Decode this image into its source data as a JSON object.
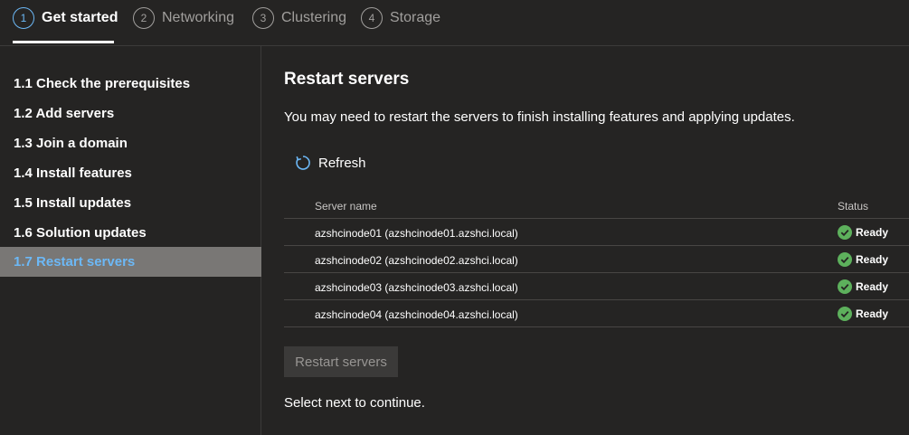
{
  "steps": [
    {
      "num": "1",
      "label": "Get started"
    },
    {
      "num": "2",
      "label": "Networking"
    },
    {
      "num": "3",
      "label": "Clustering"
    },
    {
      "num": "4",
      "label": "Storage"
    }
  ],
  "sidebar": {
    "items": [
      {
        "label": "1.1  Check the prerequisites"
      },
      {
        "label": "1.2  Add servers"
      },
      {
        "label": "1.3  Join a domain"
      },
      {
        "label": "1.4  Install features"
      },
      {
        "label": "1.5  Install updates"
      },
      {
        "label": "1.6  Solution updates"
      },
      {
        "label": "1.7  Restart servers"
      }
    ],
    "selected_index": 6
  },
  "main": {
    "title": "Restart servers",
    "description": "You may need to restart the servers to finish installing features and applying updates.",
    "refresh_label": "Refresh",
    "refresh_icon": "refresh-icon",
    "table": {
      "headers": {
        "server_name": "Server name",
        "status": "Status"
      },
      "rows": [
        {
          "server": "azshcinode01 (azshcinode01.azshci.local)",
          "status": "Ready"
        },
        {
          "server": "azshcinode02 (azshcinode02.azshci.local)",
          "status": "Ready"
        },
        {
          "server": "azshcinode03 (azshcinode03.azshci.local)",
          "status": "Ready"
        },
        {
          "server": "azshcinode04 (azshcinode04.azshci.local)",
          "status": "Ready"
        }
      ]
    },
    "restart_button": "Restart servers",
    "footer": "Select next to continue."
  },
  "colors": {
    "background": "#252423",
    "accent": "#6cb8f6",
    "success": "#5db05c",
    "selected_bg": "#797775"
  }
}
